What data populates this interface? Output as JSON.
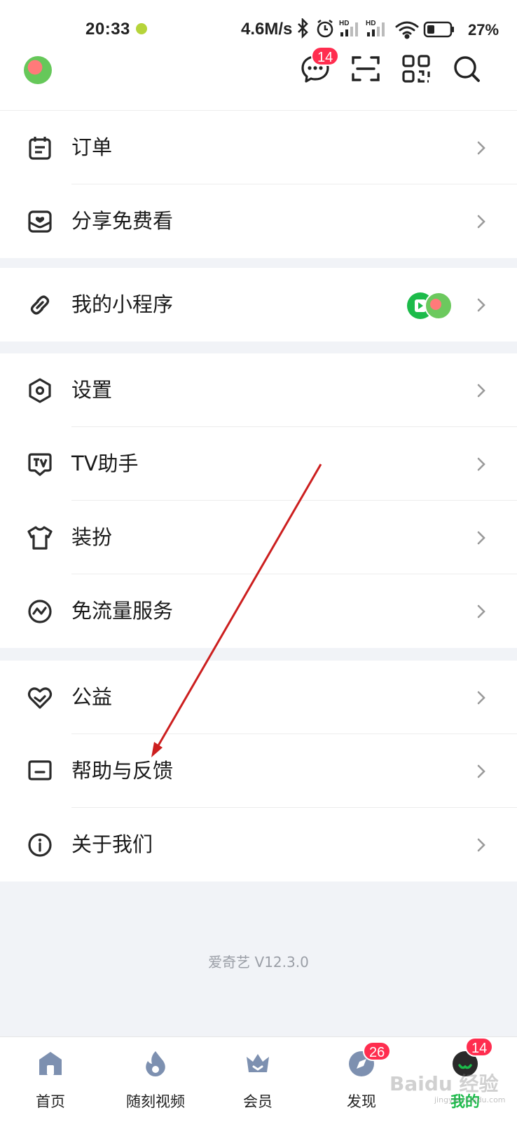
{
  "status_bar": {
    "time": "20:33",
    "net_speed": "4.6M/s",
    "battery": "27%",
    "icons": [
      "bluetooth-icon",
      "alarm-icon",
      "signal-hd-icon",
      "signal-hd-icon",
      "wifi-icon",
      "battery-icon"
    ]
  },
  "header": {
    "messages_badge": "14",
    "icons": [
      "avatar",
      "message-icon",
      "scan-icon",
      "qr-code-icon",
      "search-icon"
    ]
  },
  "menu": {
    "group1": [
      {
        "label": "订单",
        "icon": "order-icon"
      },
      {
        "label": "分享免费看",
        "icon": "share-gift-icon"
      }
    ],
    "group2": [
      {
        "label": "我的小程序",
        "icon": "link-icon"
      }
    ],
    "group3": [
      {
        "label": "设置",
        "icon": "settings-icon"
      },
      {
        "label": "TV助手",
        "icon": "tv-icon"
      },
      {
        "label": "装扮",
        "icon": "shirt-icon"
      },
      {
        "label": "免流量服务",
        "icon": "data-free-icon"
      }
    ],
    "group4": [
      {
        "label": "公益",
        "icon": "heart-icon"
      },
      {
        "label": "帮助与反馈",
        "icon": "feedback-icon"
      },
      {
        "label": "关于我们",
        "icon": "info-icon"
      }
    ]
  },
  "version": "爱奇艺 V12.3.0",
  "tabbar": {
    "tabs": [
      {
        "label": "首页",
        "icon": "home-icon"
      },
      {
        "label": "随刻视频",
        "icon": "flame-icon"
      },
      {
        "label": "会员",
        "icon": "crown-icon"
      },
      {
        "label": "发现",
        "icon": "compass-icon",
        "badge": "26"
      },
      {
        "label": "我的",
        "icon": "profile-icon",
        "badge": "14",
        "active": true
      }
    ]
  },
  "watermark": "Baidu 经验",
  "watermark_url": "jingyan.baidu.com",
  "colors": {
    "accent": "#1cbb4a",
    "badge": "#ff2d4f",
    "background": "#f1f3f7",
    "annotation_arrow": "#cc1f1f"
  }
}
